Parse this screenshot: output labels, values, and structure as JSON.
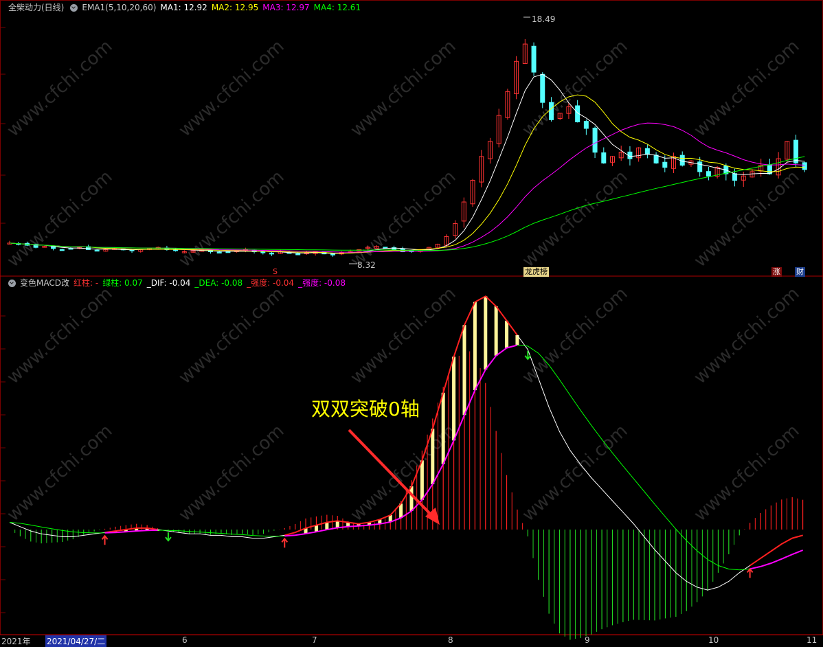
{
  "top_header": {
    "stock_name": "全柴动力(日线)",
    "indicator": "EMA1(5,10,20,60)",
    "ma1": "MA1: 12.92",
    "ma2": "MA2: 12.95",
    "ma3": "MA3: 12.97",
    "ma4": "MA4: 12.61"
  },
  "bottom_header": {
    "indicator": "变色MACD改",
    "red_bar": "红柱: -",
    "green_bar": "绿柱: 0.07",
    "dif": "_DIF: -0.04",
    "dea": "_DEA: -0.08",
    "strength1": "_强度: -0.04",
    "strength2": "_强度: -0.08"
  },
  "annotations": {
    "max_price": "18.49",
    "min_price": "8.32",
    "callout": "双双突破0轴",
    "watermark": "www.cfchi.com"
  },
  "event_badges": {
    "s": "S",
    "dragon": "龙虎榜",
    "limit": "涨",
    "finance": "财"
  },
  "x_axis": {
    "year": "2021年",
    "cursor_date": "2021/04/27/二",
    "months": [
      "6",
      "7",
      "8",
      "9",
      "10",
      "11"
    ]
  },
  "colors": {
    "bg": "#000000",
    "up": "#ff3232",
    "down": "#54ffff",
    "ma1": "#ffffff",
    "ma2": "#ffff00",
    "ma3": "#ff00ff",
    "ma4": "#00ff00",
    "macd_yellow": "#fff59a",
    "grid": "#7a0000"
  },
  "chart_data": [
    {
      "type": "candlestick",
      "title": "全柴动力(日线)",
      "ylim": [
        7.5,
        19.5
      ],
      "annotations": {
        "high": 18.49,
        "low": 8.32
      },
      "series": [
        {
          "name": "MA1",
          "last": 12.92
        },
        {
          "name": "MA2",
          "last": 12.95
        },
        {
          "name": "MA3",
          "last": 12.97
        },
        {
          "name": "MA4",
          "last": 12.61
        }
      ],
      "close_profile": [
        8.9,
        8.85,
        8.8,
        8.7,
        8.75,
        8.65,
        8.6,
        8.65,
        8.7,
        8.6,
        8.55,
        8.6,
        8.65,
        8.6,
        8.55,
        8.6,
        8.65,
        8.7,
        8.6,
        8.55,
        8.5,
        8.55,
        8.6,
        8.5,
        8.45,
        8.5,
        8.55,
        8.6,
        8.5,
        8.45,
        8.4,
        8.5,
        8.45,
        8.4,
        8.45,
        8.5,
        8.4,
        8.35,
        8.45,
        8.5,
        8.6,
        8.7,
        8.75,
        8.7,
        8.6,
        8.5,
        8.55,
        8.6,
        8.7,
        8.85,
        9.2,
        9.8,
        10.8,
        11.8,
        12.9,
        13.6,
        14.8,
        15.9,
        17.3,
        18.1,
        16.8,
        15.4,
        14.6,
        14.9,
        15.2,
        14.5,
        14.2,
        13.1,
        12.6,
        12.9,
        13.1,
        12.8,
        13.3,
        13.0,
        12.6,
        12.4,
        12.9,
        12.5,
        12.7,
        12.2,
        12.0,
        12.4,
        12.1,
        11.8,
        12.0,
        12.2,
        12.5,
        12.1,
        12.8,
        13.6,
        12.6,
        12.3
      ]
    },
    {
      "type": "macd",
      "title": "变色MACD改",
      "series": [
        {
          "name": "DIF",
          "last": -0.04
        },
        {
          "name": "DEA",
          "last": -0.08
        },
        {
          "name": "绿柱",
          "last": 0.07
        }
      ],
      "dif_profile": [
        0.05,
        0.02,
        -0.01,
        -0.03,
        -0.04,
        -0.05,
        -0.05,
        -0.04,
        -0.03,
        -0.02,
        -0.01,
        0.0,
        0.01,
        0.01,
        0.0,
        -0.01,
        -0.02,
        -0.03,
        -0.03,
        -0.04,
        -0.04,
        -0.05,
        -0.05,
        -0.06,
        -0.06,
        -0.05,
        -0.04,
        -0.02,
        0.01,
        0.03,
        0.05,
        0.06,
        0.05,
        0.04,
        0.05,
        0.07,
        0.1,
        0.18,
        0.3,
        0.48,
        0.7,
        0.95,
        1.2,
        1.42,
        1.58,
        1.62,
        1.55,
        1.45,
        1.35,
        1.25,
        1.05,
        0.85,
        0.68,
        0.55,
        0.45,
        0.36,
        0.28,
        0.2,
        0.12,
        0.04,
        -0.05,
        -0.14,
        -0.22,
        -0.3,
        -0.36,
        -0.4,
        -0.42,
        -0.4,
        -0.36,
        -0.3,
        -0.25,
        -0.2,
        -0.15,
        -0.1,
        -0.06,
        -0.04
      ]
    }
  ]
}
